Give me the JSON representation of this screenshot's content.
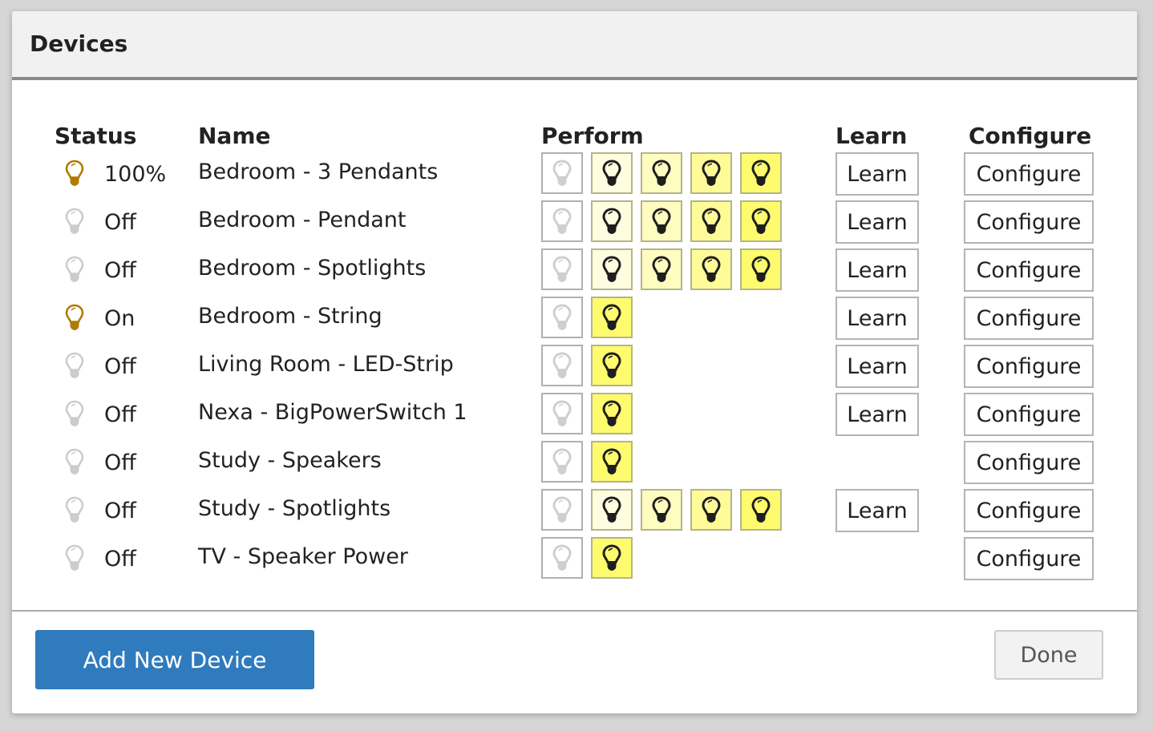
{
  "dialog": {
    "title": "Devices"
  },
  "columns": {
    "status": "Status",
    "name": "Name",
    "perform": "Perform",
    "learn": "Learn",
    "configure": "Configure"
  },
  "colors": {
    "status_on": "#b07a00",
    "status_off": "#cccccc",
    "perform_off_border": "#b0b0b0",
    "dim_levels": [
      "#fffde0",
      "#fffcc0",
      "#fffb99",
      "#fffb6e"
    ],
    "on_button": "#fffb6e",
    "primary": "#2f7bbd"
  },
  "devices": [
    {
      "status": "100%",
      "on": true,
      "name": "Bedroom - 3 Pendants",
      "perform": "dimmer",
      "learn": "Learn",
      "configure": "Configure"
    },
    {
      "status": "Off",
      "on": false,
      "name": "Bedroom - Pendant",
      "perform": "dimmer",
      "learn": "Learn",
      "configure": "Configure"
    },
    {
      "status": "Off",
      "on": false,
      "name": "Bedroom - Spotlights",
      "perform": "dimmer",
      "learn": "Learn",
      "configure": "Configure"
    },
    {
      "status": "On",
      "on": true,
      "name": "Bedroom - String",
      "perform": "switch",
      "learn": "Learn",
      "configure": "Configure"
    },
    {
      "status": "Off",
      "on": false,
      "name": "Living Room - LED-Strip",
      "perform": "switch",
      "learn": "Learn",
      "configure": "Configure"
    },
    {
      "status": "Off",
      "on": false,
      "name": "Nexa - BigPowerSwitch 1",
      "perform": "switch",
      "learn": "Learn",
      "configure": "Configure"
    },
    {
      "status": "Off",
      "on": false,
      "name": "Study - Speakers",
      "perform": "switch",
      "learn": null,
      "configure": "Configure"
    },
    {
      "status": "Off",
      "on": false,
      "name": "Study - Spotlights",
      "perform": "dimmer",
      "learn": "Learn",
      "configure": "Configure"
    },
    {
      "status": "Off",
      "on": false,
      "name": "TV - Speaker Power",
      "perform": "switch",
      "learn": null,
      "configure": "Configure"
    }
  ],
  "footer": {
    "add_label": "Add New Device",
    "done_label": "Done"
  }
}
